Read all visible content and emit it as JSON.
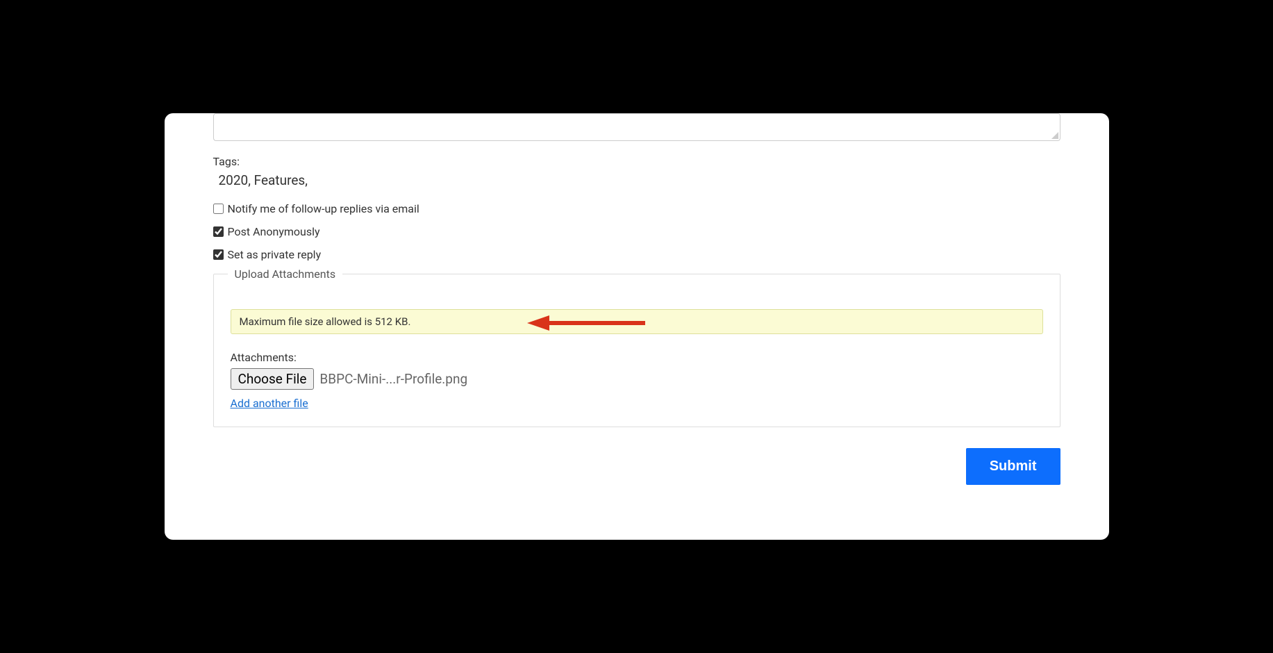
{
  "tags": {
    "label": "Tags:",
    "value": "2020, Features,"
  },
  "checkboxes": {
    "notify": {
      "label": "Notify me of follow-up replies via email",
      "checked": false
    },
    "anonymous": {
      "label": "Post Anonymously",
      "checked": true
    },
    "private": {
      "label": "Set as private reply",
      "checked": true
    }
  },
  "upload": {
    "legend": "Upload Attachments",
    "notice": "Maximum file size allowed is 512 KB.",
    "attachments_label": "Attachments:",
    "choose_file": "Choose File",
    "file_name": "BBPC-Mini-...r-Profile.png",
    "add_another": "Add another file"
  },
  "submit": "Submit"
}
